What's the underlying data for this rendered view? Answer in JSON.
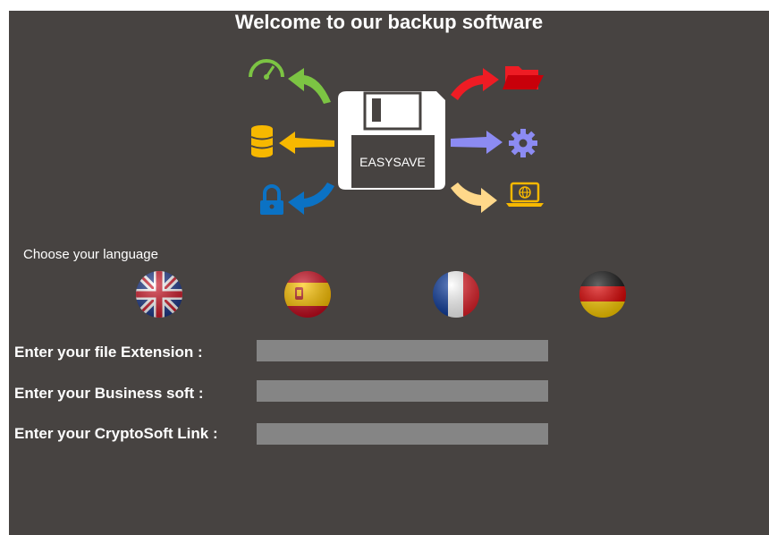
{
  "header": {
    "title": "Welcome to our backup software"
  },
  "logo": {
    "label": "EASYSAVE"
  },
  "icons": [
    "speed-gauge-icon",
    "database-icon",
    "lock-icon",
    "folder-icon",
    "gear-icon",
    "laptop-web-icon"
  ],
  "language": {
    "label": "Choose your language",
    "options": [
      "english-flag-icon",
      "spanish-flag-icon",
      "french-flag-icon",
      "german-flag-icon"
    ]
  },
  "fields": {
    "extension": {
      "label": "Enter your file Extension :",
      "value": ""
    },
    "business": {
      "label": "Enter your Business soft :",
      "value": ""
    },
    "crypto": {
      "label": "Enter your CryptoSoft Link :",
      "value": ""
    }
  },
  "colors": {
    "background": "#474341",
    "input": "#858585",
    "green": "#7cc443",
    "yellow": "#f7b800",
    "blue": "#0b72c4",
    "red": "#ee1c24",
    "lavender": "#8c8bf2",
    "pale_yellow": "#ffd88a"
  }
}
